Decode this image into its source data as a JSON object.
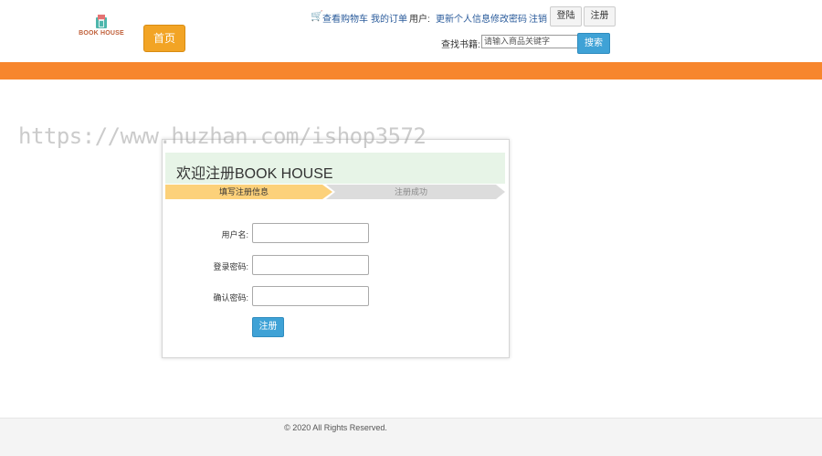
{
  "header": {
    "logo_text": "BOOK HOUSE",
    "home_button": "首页",
    "links": {
      "cart": "查看购物车",
      "orders": "我的订单",
      "user_label": "用户:",
      "profile": "更新个人信息",
      "change_password": "修改密码",
      "logout": "注销"
    },
    "login_button": "登陆",
    "register_button": "注册",
    "search": {
      "label": "查找书籍:",
      "placeholder": "请输入商品关键字",
      "button": "搜索"
    }
  },
  "watermark": "https://www.huzhan.com/ishop3572",
  "register": {
    "title": "欢迎注册BOOK HOUSE",
    "steps": [
      "填写注册信息",
      "注册成功"
    ],
    "fields": {
      "username_label": "用户名:",
      "password_label": "登录密码:",
      "confirm_label": "确认密码:"
    },
    "submit": "注册"
  },
  "footer": {
    "copyright": "© 2020 All Rights Reserved."
  },
  "colors": {
    "accent_orange": "#f7862d",
    "button_blue": "#3fa2d6",
    "home_button": "#f2a425"
  }
}
